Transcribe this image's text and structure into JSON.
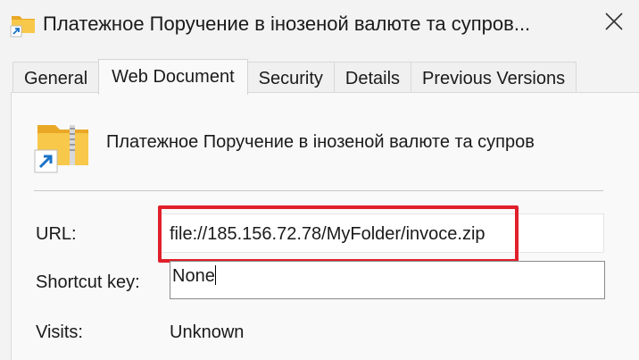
{
  "window": {
    "title": "Платежное Поручение в інозеной валюте та супров...",
    "close_icon": "close-icon",
    "title_icon": "folder-shortcut-icon"
  },
  "tabs": [
    {
      "label": "General",
      "active": false
    },
    {
      "label": "Web Document",
      "active": true
    },
    {
      "label": "Security",
      "active": false
    },
    {
      "label": "Details",
      "active": false
    },
    {
      "label": "Previous Versions",
      "active": false
    }
  ],
  "document": {
    "name": "Платежное Поручение в інозеной валюте та супров",
    "icon": "zip-folder-shortcut-icon"
  },
  "fields": {
    "url_label": "URL:",
    "url_value": "file://185.156.72.78/MyFolder/invoce.zip",
    "shortcut_label": "Shortcut key:",
    "shortcut_value": "None",
    "visits_label": "Visits:",
    "visits_value": "Unknown"
  },
  "colors": {
    "highlight": "#e0202a",
    "folder": "#f5c142",
    "shortcut_arrow": "#1a73c8"
  }
}
